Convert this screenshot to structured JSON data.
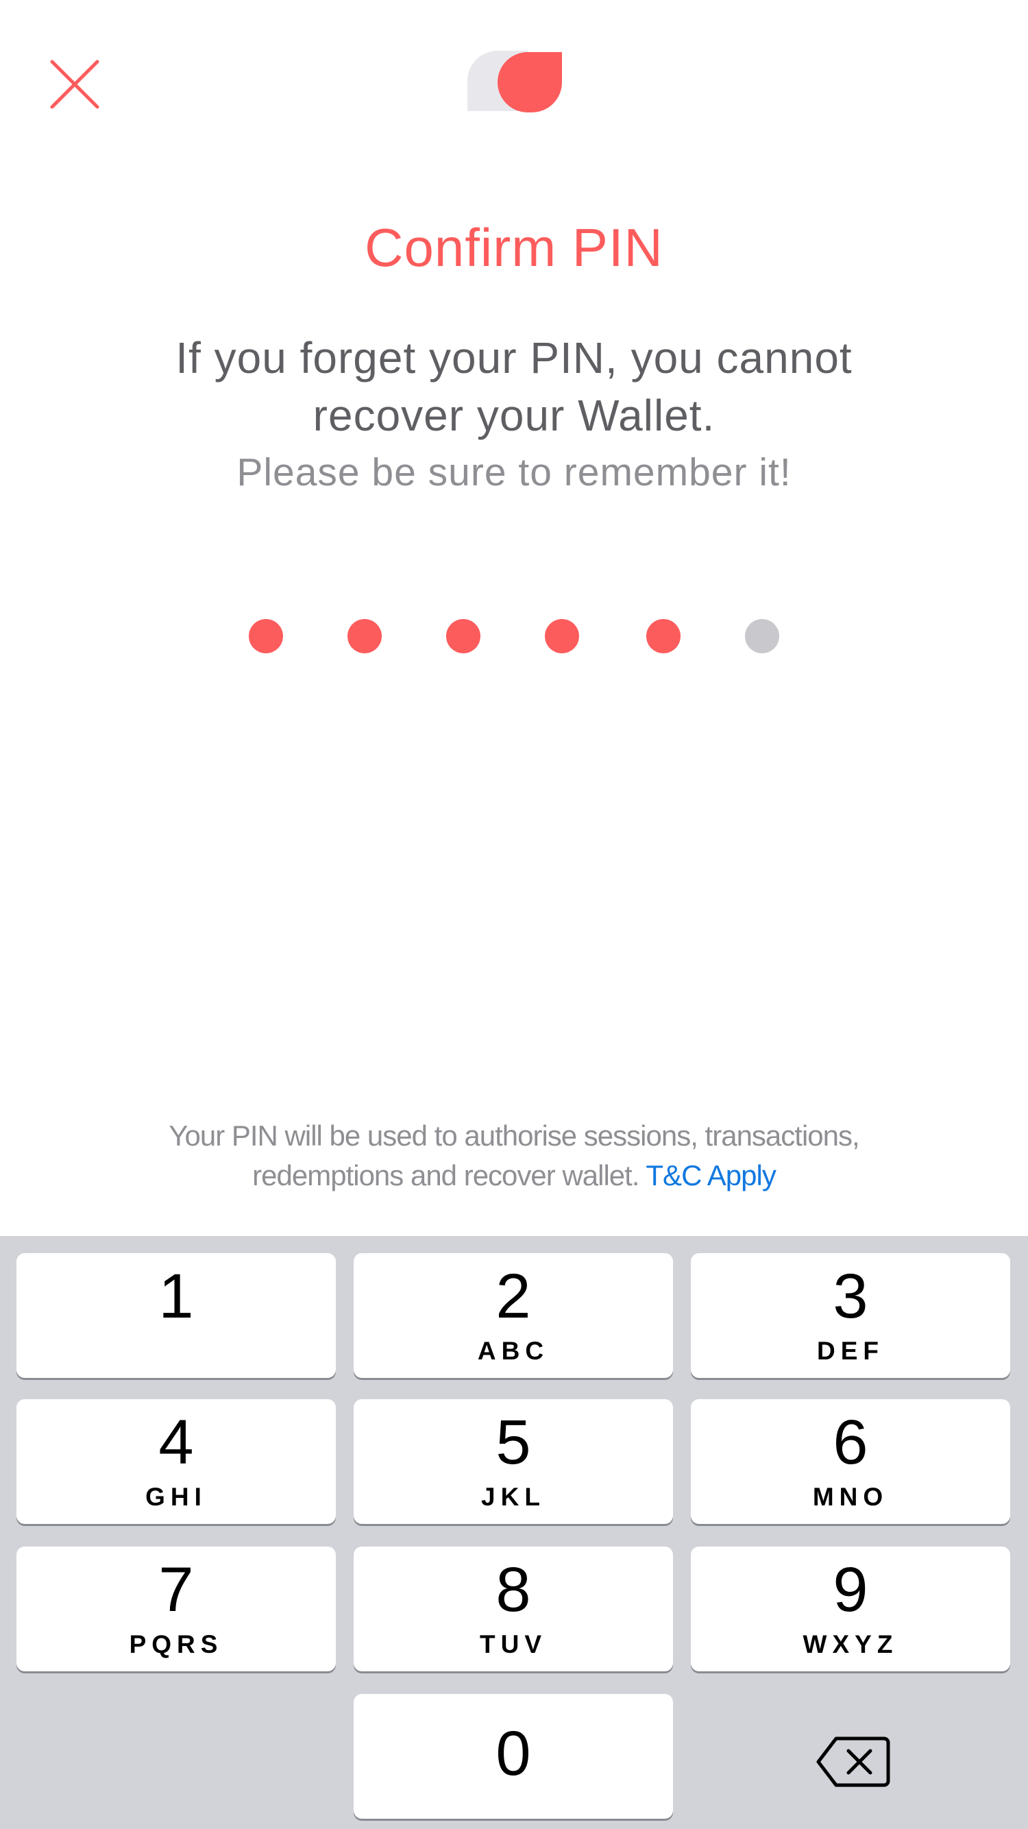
{
  "header": {
    "close_icon": "close-icon",
    "logo_icon": "app-logo-icon"
  },
  "colors": {
    "accent": "#fc5c5c",
    "dot_empty": "#c8c8cd",
    "link": "#1178e0",
    "keypad_bg": "#d1d3d9"
  },
  "main": {
    "title": "Confirm PIN",
    "warning": "If you forget your PIN, you cannot recover your Wallet.",
    "reminder": "Please be sure to remember it!",
    "pin": {
      "length": 6,
      "filled": 5
    },
    "info_text": "Your PIN will be used to authorise sessions, transactions, redemptions and recover wallet.",
    "info_link": "T&C Apply"
  },
  "keypad": {
    "keys": [
      {
        "digit": "1",
        "letters": ""
      },
      {
        "digit": "2",
        "letters": "ABC"
      },
      {
        "digit": "3",
        "letters": "DEF"
      },
      {
        "digit": "4",
        "letters": "GHI"
      },
      {
        "digit": "5",
        "letters": "JKL"
      },
      {
        "digit": "6",
        "letters": "MNO"
      },
      {
        "digit": "7",
        "letters": "PQRS"
      },
      {
        "digit": "8",
        "letters": "TUV"
      },
      {
        "digit": "9",
        "letters": "WXYZ"
      },
      {
        "digit": "0",
        "letters": ""
      }
    ],
    "backspace_icon": "backspace-icon"
  }
}
